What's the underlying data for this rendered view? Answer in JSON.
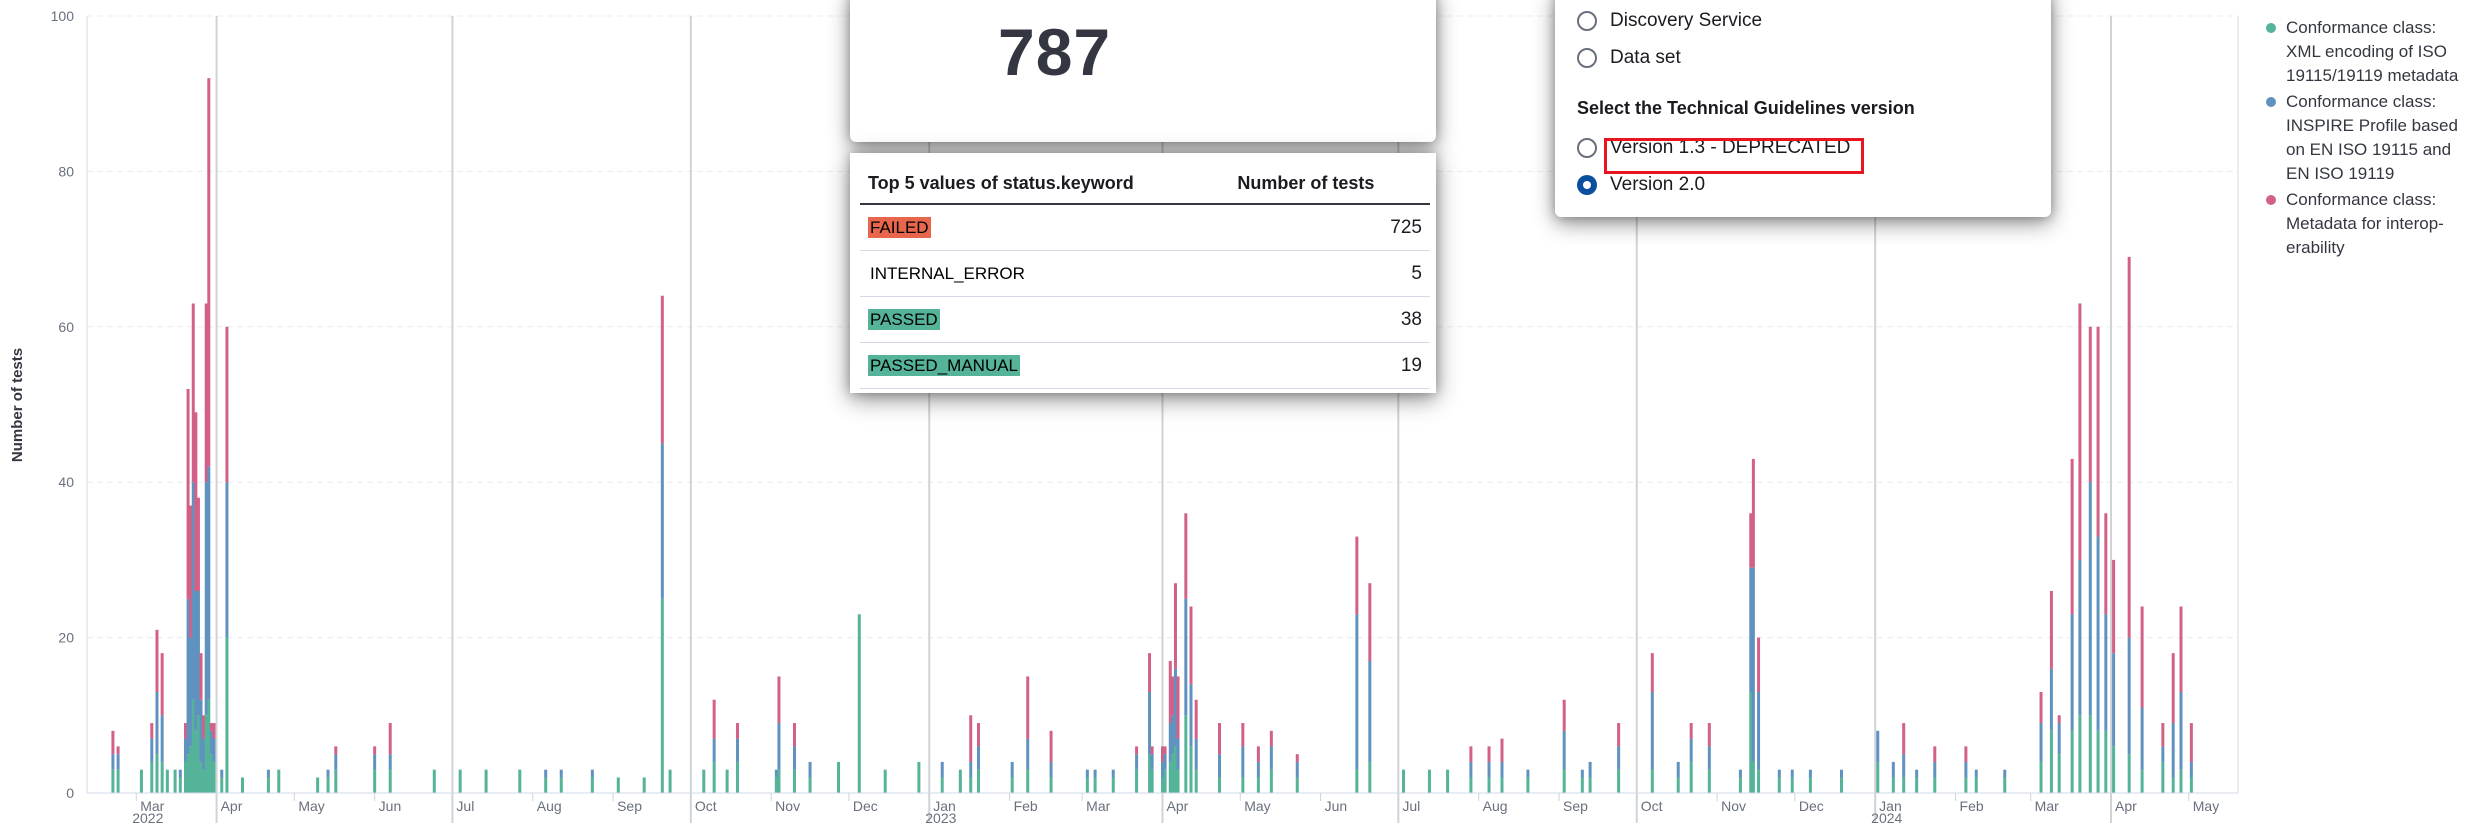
{
  "chart_data": {
    "type": "bar",
    "ylabel": "Number of tests",
    "ylim": [
      0,
      100
    ],
    "yticks": [
      "0",
      "20",
      "40",
      "60",
      "80",
      "100"
    ],
    "xticks": [
      {
        "date": "2022-03-01",
        "label": "Mar",
        "sub": "2022"
      },
      {
        "date": "2022-04-01",
        "label": "Apr",
        "sub": ""
      },
      {
        "date": "2022-05-01",
        "label": "May",
        "sub": ""
      },
      {
        "date": "2022-06-01",
        "label": "Jun",
        "sub": ""
      },
      {
        "date": "2022-07-01",
        "label": "Jul",
        "sub": ""
      },
      {
        "date": "2022-08-01",
        "label": "Aug",
        "sub": ""
      },
      {
        "date": "2022-09-01",
        "label": "Sep",
        "sub": ""
      },
      {
        "date": "2022-10-01",
        "label": "Oct",
        "sub": ""
      },
      {
        "date": "2022-11-01",
        "label": "Nov",
        "sub": ""
      },
      {
        "date": "2022-12-01",
        "label": "Dec",
        "sub": ""
      },
      {
        "date": "2023-01-01",
        "label": "Jan",
        "sub": "2023"
      },
      {
        "date": "2023-02-01",
        "label": "Feb",
        "sub": ""
      },
      {
        "date": "2023-03-01",
        "label": "Mar",
        "sub": ""
      },
      {
        "date": "2023-04-01",
        "label": "Apr",
        "sub": ""
      },
      {
        "date": "2023-05-01",
        "label": "May",
        "sub": ""
      },
      {
        "date": "2023-06-01",
        "label": "Jun",
        "sub": ""
      },
      {
        "date": "2023-07-01",
        "label": "Jul",
        "sub": ""
      },
      {
        "date": "2023-08-01",
        "label": "Aug",
        "sub": ""
      },
      {
        "date": "2023-09-01",
        "label": "Sep",
        "sub": ""
      },
      {
        "date": "2023-10-01",
        "label": "Oct",
        "sub": ""
      },
      {
        "date": "2023-11-01",
        "label": "Nov",
        "sub": ""
      },
      {
        "date": "2023-12-01",
        "label": "Dec",
        "sub": ""
      },
      {
        "date": "2024-01-01",
        "label": "Jan",
        "sub": "2024"
      },
      {
        "date": "2024-02-01",
        "label": "Feb",
        "sub": ""
      },
      {
        "date": "2024-03-01",
        "label": "Mar",
        "sub": ""
      },
      {
        "date": "2024-04-01",
        "label": "Apr",
        "sub": ""
      },
      {
        "date": "2024-05-01",
        "label": "May",
        "sub": ""
      }
    ],
    "month_separators": [
      "2022-04-01",
      "2022-07-01",
      "2022-10-01",
      "2023-01-01",
      "2023-04-01",
      "2023-07-01",
      "2023-10-01",
      "2024-01-01",
      "2024-04-01"
    ],
    "series": [
      {
        "name": "Conformance class: XML encoding of ISO 19115/19119 metadata",
        "color": "#54b399"
      },
      {
        "name": "Conformance class: INSPIRE Profile based on EN ISO 19115 and EN ISO 19119",
        "color": "#6092c0"
      },
      {
        "name": "Conformance class: Metadata for interoperability",
        "color": "#d36086"
      }
    ],
    "stacks": [
      {
        "date": "2022-02-20",
        "values": [
          3,
          2,
          3
        ]
      },
      {
        "date": "2022-02-22",
        "values": [
          3,
          2,
          1
        ]
      },
      {
        "date": "2022-03-03",
        "values": [
          3,
          0,
          0
        ]
      },
      {
        "date": "2022-03-07",
        "values": [
          4,
          3,
          2
        ]
      },
      {
        "date": "2022-03-09",
        "values": [
          5,
          8,
          8
        ]
      },
      {
        "date": "2022-03-11",
        "values": [
          4,
          6,
          8
        ]
      },
      {
        "date": "2022-03-13",
        "values": [
          3,
          0,
          0
        ]
      },
      {
        "date": "2022-03-16",
        "values": [
          3,
          0,
          0
        ]
      },
      {
        "date": "2022-03-18",
        "values": [
          2,
          1,
          0
        ]
      },
      {
        "date": "2022-03-20",
        "values": [
          4,
          3,
          2
        ]
      },
      {
        "date": "2022-03-21",
        "values": [
          5,
          20,
          27
        ]
      },
      {
        "date": "2022-03-22",
        "values": [
          6,
          14,
          17
        ]
      },
      {
        "date": "2022-03-23",
        "values": [
          12,
          28,
          23
        ]
      },
      {
        "date": "2022-03-24",
        "values": [
          8,
          18,
          23
        ]
      },
      {
        "date": "2022-03-25",
        "values": [
          10,
          16,
          12
        ]
      },
      {
        "date": "2022-03-26",
        "values": [
          4,
          8,
          6
        ]
      },
      {
        "date": "2022-03-27",
        "values": [
          3,
          4,
          3
        ]
      },
      {
        "date": "2022-03-28",
        "values": [
          10,
          30,
          23
        ]
      },
      {
        "date": "2022-03-29",
        "values": [
          12,
          30,
          50
        ]
      },
      {
        "date": "2022-03-30",
        "values": [
          5,
          3,
          1
        ]
      },
      {
        "date": "2022-03-31",
        "values": [
          4,
          3,
          2
        ]
      },
      {
        "date": "2022-04-03",
        "values": [
          2,
          1,
          0
        ]
      },
      {
        "date": "2022-04-05",
        "values": [
          20,
          20,
          20
        ]
      },
      {
        "date": "2022-04-11",
        "values": [
          2,
          0,
          0
        ]
      },
      {
        "date": "2022-04-21",
        "values": [
          2,
          1,
          0
        ]
      },
      {
        "date": "2022-04-25",
        "values": [
          3,
          0,
          0
        ]
      },
      {
        "date": "2022-05-10",
        "values": [
          2,
          0,
          0
        ]
      },
      {
        "date": "2022-05-14",
        "values": [
          2,
          1,
          0
        ]
      },
      {
        "date": "2022-05-17",
        "values": [
          3,
          2,
          1
        ]
      },
      {
        "date": "2022-06-01",
        "values": [
          3,
          2,
          1
        ]
      },
      {
        "date": "2022-06-07",
        "values": [
          3,
          2,
          4
        ]
      },
      {
        "date": "2022-06-24",
        "values": [
          3,
          0,
          0
        ]
      },
      {
        "date": "2022-07-04",
        "values": [
          3,
          0,
          0
        ]
      },
      {
        "date": "2022-07-14",
        "values": [
          3,
          0,
          0
        ]
      },
      {
        "date": "2022-07-27",
        "values": [
          3,
          0,
          0
        ]
      },
      {
        "date": "2022-08-06",
        "values": [
          2,
          1,
          0
        ]
      },
      {
        "date": "2022-08-12",
        "values": [
          2,
          1,
          0
        ]
      },
      {
        "date": "2022-08-24",
        "values": [
          2,
          1,
          0
        ]
      },
      {
        "date": "2022-09-03",
        "values": [
          2,
          0,
          0
        ]
      },
      {
        "date": "2022-09-13",
        "values": [
          2,
          0,
          0
        ]
      },
      {
        "date": "2022-09-20",
        "values": [
          25,
          20,
          19
        ]
      },
      {
        "date": "2022-09-23",
        "values": [
          3,
          0,
          0
        ]
      },
      {
        "date": "2022-10-06",
        "values": [
          3,
          0,
          0
        ]
      },
      {
        "date": "2022-10-10",
        "values": [
          4,
          3,
          5
        ]
      },
      {
        "date": "2022-10-15",
        "values": [
          3,
          0,
          0
        ]
      },
      {
        "date": "2022-10-19",
        "values": [
          4,
          3,
          2
        ]
      },
      {
        "date": "2022-11-03",
        "values": [
          2,
          1,
          0
        ]
      },
      {
        "date": "2022-11-04",
        "values": [
          3,
          6,
          6
        ]
      },
      {
        "date": "2022-11-10",
        "values": [
          3,
          3,
          3
        ]
      },
      {
        "date": "2022-11-16",
        "values": [
          2,
          2,
          0
        ]
      },
      {
        "date": "2022-11-27",
        "values": [
          4,
          0,
          0
        ]
      },
      {
        "date": "2022-12-05",
        "values": [
          23,
          0,
          0
        ]
      },
      {
        "date": "2022-12-15",
        "values": [
          3,
          0,
          0
        ]
      },
      {
        "date": "2022-12-28",
        "values": [
          4,
          0,
          0
        ]
      },
      {
        "date": "2023-01-06",
        "values": [
          2,
          2,
          0
        ]
      },
      {
        "date": "2023-01-13",
        "values": [
          3,
          0,
          0
        ]
      },
      {
        "date": "2023-01-17",
        "values": [
          2,
          2,
          6
        ]
      },
      {
        "date": "2023-01-20",
        "values": [
          3,
          3,
          3
        ]
      },
      {
        "date": "2023-02-02",
        "values": [
          2,
          2,
          0
        ]
      },
      {
        "date": "2023-02-08",
        "values": [
          3,
          4,
          8
        ]
      },
      {
        "date": "2023-02-17",
        "values": [
          2,
          2,
          4
        ]
      },
      {
        "date": "2023-03-03",
        "values": [
          2,
          1,
          0
        ]
      },
      {
        "date": "2023-03-06",
        "values": [
          2,
          1,
          0
        ]
      },
      {
        "date": "2023-03-13",
        "values": [
          2,
          1,
          0
        ]
      },
      {
        "date": "2023-03-22",
        "values": [
          3,
          2,
          1
        ]
      },
      {
        "date": "2023-03-27",
        "values": [
          5,
          8,
          5
        ]
      },
      {
        "date": "2023-03-28",
        "values": [
          3,
          2,
          1
        ]
      },
      {
        "date": "2023-04-01",
        "values": [
          2,
          2,
          2
        ]
      },
      {
        "date": "2023-04-02",
        "values": [
          3,
          2,
          1
        ]
      },
      {
        "date": "2023-04-04",
        "values": [
          4,
          5,
          8
        ]
      },
      {
        "date": "2023-04-05",
        "values": [
          5,
          5,
          5
        ]
      },
      {
        "date": "2023-04-06",
        "values": [
          6,
          10,
          11
        ]
      },
      {
        "date": "2023-04-07",
        "values": [
          3,
          4,
          8
        ]
      },
      {
        "date": "2023-04-10",
        "values": [
          10,
          15,
          11
        ]
      },
      {
        "date": "2023-04-12",
        "values": [
          6,
          8,
          10
        ]
      },
      {
        "date": "2023-04-14",
        "values": [
          3,
          4,
          5
        ]
      },
      {
        "date": "2023-04-23",
        "values": [
          2,
          3,
          4
        ]
      },
      {
        "date": "2023-05-02",
        "values": [
          2,
          4,
          3
        ]
      },
      {
        "date": "2023-05-08",
        "values": [
          2,
          2,
          2
        ]
      },
      {
        "date": "2023-05-13",
        "values": [
          3,
          3,
          2
        ]
      },
      {
        "date": "2023-05-23",
        "values": [
          2,
          2,
          1
        ]
      },
      {
        "date": "2023-06-15",
        "values": [
          3,
          20,
          10
        ]
      },
      {
        "date": "2023-06-20",
        "values": [
          4,
          13,
          10
        ]
      },
      {
        "date": "2023-07-03",
        "values": [
          3,
          0,
          0
        ]
      },
      {
        "date": "2023-07-13",
        "values": [
          3,
          0,
          0
        ]
      },
      {
        "date": "2023-07-20",
        "values": [
          3,
          0,
          0
        ]
      },
      {
        "date": "2023-07-29",
        "values": [
          2,
          2,
          2
        ]
      },
      {
        "date": "2023-08-05",
        "values": [
          2,
          2,
          2
        ]
      },
      {
        "date": "2023-08-10",
        "values": [
          2,
          2,
          3
        ]
      },
      {
        "date": "2023-08-20",
        "values": [
          2,
          1,
          0
        ]
      },
      {
        "date": "2023-09-03",
        "values": [
          3,
          5,
          4
        ]
      },
      {
        "date": "2023-09-10",
        "values": [
          2,
          1,
          0
        ]
      },
      {
        "date": "2023-09-13",
        "values": [
          2,
          2,
          0
        ]
      },
      {
        "date": "2023-09-24",
        "values": [
          3,
          3,
          3
        ]
      },
      {
        "date": "2023-10-07",
        "values": [
          3,
          10,
          5
        ]
      },
      {
        "date": "2023-10-17",
        "values": [
          2,
          2,
          0
        ]
      },
      {
        "date": "2023-10-22",
        "values": [
          4,
          3,
          2
        ]
      },
      {
        "date": "2023-10-29",
        "values": [
          3,
          3,
          3
        ]
      },
      {
        "date": "2023-11-10",
        "values": [
          2,
          1,
          0
        ]
      },
      {
        "date": "2023-11-14",
        "values": [
          13,
          16,
          7
        ]
      },
      {
        "date": "2023-11-15",
        "values": [
          4,
          25,
          14
        ]
      },
      {
        "date": "2023-11-17",
        "values": [
          3,
          10,
          7
        ]
      },
      {
        "date": "2023-11-25",
        "values": [
          2,
          1,
          0
        ]
      },
      {
        "date": "2023-11-30",
        "values": [
          2,
          1,
          0
        ]
      },
      {
        "date": "2023-12-07",
        "values": [
          2,
          1,
          0
        ]
      },
      {
        "date": "2023-12-19",
        "values": [
          2,
          1,
          0
        ]
      },
      {
        "date": "2024-01-02",
        "values": [
          4,
          4,
          0
        ]
      },
      {
        "date": "2024-01-08",
        "values": [
          2,
          2,
          0
        ]
      },
      {
        "date": "2024-01-12",
        "values": [
          2,
          3,
          4
        ]
      },
      {
        "date": "2024-01-17",
        "values": [
          2,
          1,
          0
        ]
      },
      {
        "date": "2024-01-24",
        "values": [
          2,
          2,
          2
        ]
      },
      {
        "date": "2024-02-05",
        "values": [
          2,
          2,
          2
        ]
      },
      {
        "date": "2024-02-09",
        "values": [
          2,
          1,
          0
        ]
      },
      {
        "date": "2024-02-20",
        "values": [
          2,
          1,
          0
        ]
      },
      {
        "date": "2024-03-05",
        "values": [
          4,
          5,
          4
        ]
      },
      {
        "date": "2024-03-09",
        "values": [
          8,
          8,
          10
        ]
      },
      {
        "date": "2024-03-12",
        "values": [
          5,
          4,
          1
        ]
      },
      {
        "date": "2024-03-17",
        "values": [
          8,
          15,
          20
        ]
      },
      {
        "date": "2024-03-20",
        "values": [
          10,
          20,
          33
        ]
      },
      {
        "date": "2024-03-24",
        "values": [
          10,
          30,
          20
        ]
      },
      {
        "date": "2024-03-27",
        "values": [
          8,
          25,
          27
        ]
      },
      {
        "date": "2024-03-30",
        "values": [
          8,
          15,
          13
        ]
      },
      {
        "date": "2024-04-02",
        "values": [
          6,
          12,
          12
        ]
      },
      {
        "date": "2024-04-08",
        "values": [
          5,
          15,
          49
        ]
      },
      {
        "date": "2024-04-13",
        "values": [
          3,
          8,
          13
        ]
      },
      {
        "date": "2024-04-21",
        "values": [
          4,
          2,
          3
        ]
      },
      {
        "date": "2024-04-25",
        "values": [
          2,
          7,
          9
        ]
      },
      {
        "date": "2024-04-28",
        "values": [
          3,
          10,
          11
        ]
      },
      {
        "date": "2024-05-02",
        "values": [
          2,
          2,
          5
        ]
      }
    ]
  },
  "metric": {
    "value": "787"
  },
  "top_values_table": {
    "header_name": "Top 5 values of status.keyword",
    "header_count": "Number of tests",
    "rows": [
      {
        "label": "FAILED",
        "count": "725",
        "bg": "#e7664c"
      },
      {
        "label": "INTERNAL_ERROR",
        "count": "5",
        "bg": "#ffffff"
      },
      {
        "label": "PASSED",
        "count": "38",
        "bg": "#54b399"
      },
      {
        "label": "PASSED_MANUAL",
        "count": "19",
        "bg": "#54b399"
      }
    ]
  },
  "filter_panel": {
    "resource_options": [
      {
        "label": "Discovery Service",
        "selected": false
      },
      {
        "label": "Data set",
        "selected": false
      }
    ],
    "guidelines_title": "Select the Technical Guidelines version",
    "guidelines_options": [
      {
        "label": "Version 1.3 - DEPRECATED",
        "selected": false
      },
      {
        "label": "Version 2.0",
        "selected": true
      }
    ]
  },
  "legend": {
    "items": [
      {
        "lines": [
          "Conformance class:",
          "XML encoding of ISO",
          "19115/19119 metadata"
        ],
        "color": "#54b399"
      },
      {
        "lines": [
          "Conformance class:",
          "INSPIRE Profile based",
          "on EN ISO 19115 and",
          "EN ISO 19119"
        ],
        "color": "#6092c0"
      },
      {
        "lines": [
          "Conformance class:",
          "Metadata for interop-",
          "erability"
        ],
        "color": "#d36086"
      }
    ]
  }
}
